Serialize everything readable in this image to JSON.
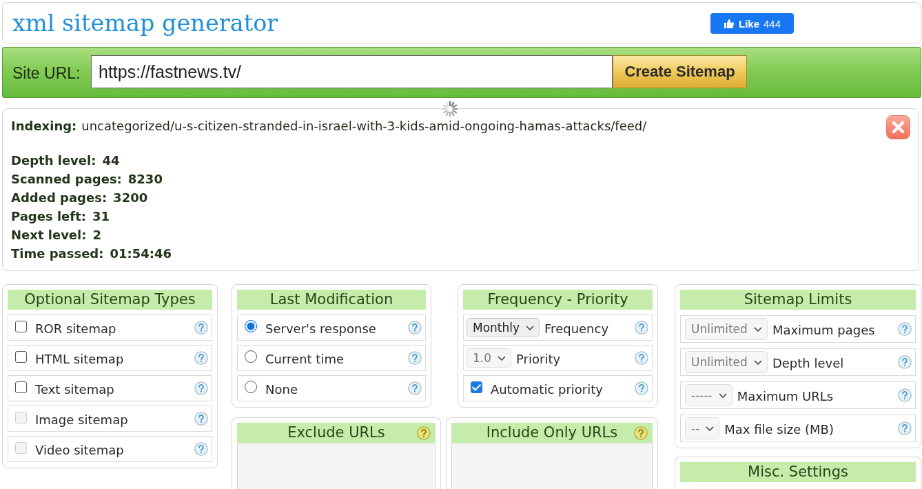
{
  "header": {
    "title": "xml sitemap generator",
    "like_button": {
      "label": "Like",
      "count": "444"
    }
  },
  "url_form": {
    "label": "Site URL:",
    "value": "https://fastnews.tv/",
    "submit_button": "Create Sitemap"
  },
  "progress": {
    "indexing": {
      "label": "Indexing:",
      "value": "uncategorized/u-s-citizen-stranded-in-israel-with-3-kids-amid-ongoing-hamas-attacks/feed/"
    },
    "stats": [
      {
        "label": "Depth level:",
        "value": "44"
      },
      {
        "label": "Scanned pages:",
        "value": "8230"
      },
      {
        "label": "Added pages:",
        "value": "3200"
      },
      {
        "label": "Pages left:",
        "value": "31"
      },
      {
        "label": "Next level:",
        "value": "2"
      },
      {
        "label": "Time passed:",
        "value": "01:54:46"
      }
    ]
  },
  "optional_sitemap_types": {
    "title": "Optional Sitemap Types",
    "items": [
      {
        "label": "ROR sitemap",
        "checked": false,
        "disabled": false
      },
      {
        "label": "HTML sitemap",
        "checked": false,
        "disabled": false
      },
      {
        "label": "Text sitemap",
        "checked": false,
        "disabled": false
      },
      {
        "label": "Image sitemap",
        "checked": false,
        "disabled": true
      },
      {
        "label": "Video sitemap",
        "checked": false,
        "disabled": true
      }
    ]
  },
  "last_modification": {
    "title": "Last Modification",
    "options": [
      {
        "label": "Server's response",
        "selected": true
      },
      {
        "label": "Current time",
        "selected": false
      },
      {
        "label": "None",
        "selected": false
      }
    ]
  },
  "frequency_priority": {
    "title": "Frequency - Priority",
    "rows": [
      {
        "kind": "select",
        "value": "Monthly",
        "label": "Frequency",
        "disabled": false
      },
      {
        "kind": "select",
        "value": "1.0",
        "label": "Priority",
        "disabled": true
      },
      {
        "kind": "checkbox",
        "label": "Automatic priority",
        "checked": true
      }
    ]
  },
  "sitemap_limits": {
    "title": "Sitemap Limits",
    "rows": [
      {
        "value": "Unlimited",
        "label": "Maximum pages",
        "disabled": true
      },
      {
        "value": "Unlimited",
        "label": "Depth level",
        "disabled": true
      },
      {
        "value": "-----",
        "label": "Maximum URLs",
        "disabled": true
      },
      {
        "value": "--",
        "label": "Max file size (MB)",
        "disabled": true
      }
    ]
  },
  "exclude_urls": {
    "title": "Exclude URLs"
  },
  "include_only_urls": {
    "title": "Include Only URLs"
  },
  "misc_settings": {
    "title": "Misc. Settings"
  }
}
